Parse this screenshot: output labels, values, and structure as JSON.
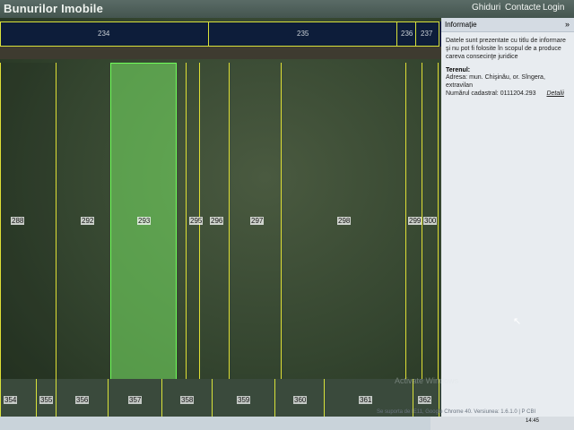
{
  "header": {
    "title": "Bunurilor Imobile",
    "nav": [
      "Ghiduri",
      "Contacte",
      "Login"
    ]
  },
  "map": {
    "top_parcels": [
      "234",
      "235",
      "236",
      "237"
    ],
    "parcels": [
      "288",
      "292",
      "293",
      "295",
      "296",
      "297",
      "298",
      "299",
      "300"
    ],
    "selected_parcel": "293",
    "bottom_parcels": [
      "354",
      "355",
      "356",
      "357",
      "358",
      "359",
      "360",
      "361",
      "362"
    ],
    "highlight_color": "#6fff5a",
    "boundary_color": "#dede35"
  },
  "panel": {
    "title": "Informaţie",
    "collapse_icon": "»",
    "notice": "Datele sunt prezentate cu titlu de informare şi nu pot fi folosite în scopul de a produce careva consecinţe juridice",
    "section": "Terenul:",
    "address": "Adresa: mun. Chişinău, or. Sîngera, extravilan",
    "cadastral": "Numărul cadastral: 0111204.293",
    "details_link": "Detalii"
  },
  "footer": {
    "support": "Se suporta de IE11, Google Chrome 40. Versiunea: 1.6.1.0 | P CBI",
    "watermark": "Activate Windows",
    "clock": "14:45"
  }
}
